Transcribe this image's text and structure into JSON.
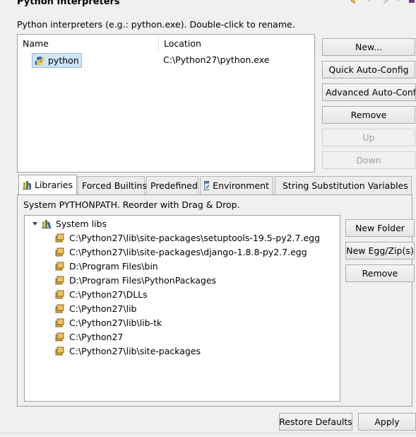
{
  "header": {
    "title": "Python Interpreters",
    "description": "Python interpreters (e.g.: python.exe).   Double-click to rename."
  },
  "interpreters": {
    "columns": [
      "Name",
      "Location"
    ],
    "rows": [
      {
        "name": "python",
        "location": "C:\\Python27\\python.exe"
      }
    ]
  },
  "side_buttons": {
    "new": "New...",
    "quick_auto_config": "Quick Auto-Config",
    "advanced_auto_config": "Advanced Auto-Config",
    "remove": "Remove",
    "up": "Up",
    "down": "Down"
  },
  "tabs": [
    {
      "label": "Libraries",
      "icon": "libraries-icon"
    },
    {
      "label": "Forced Builtins"
    },
    {
      "label": "Predefined"
    },
    {
      "label": "Environment",
      "icon": "environment-icon"
    },
    {
      "label": "String Substitution Variables",
      "icon": "variables-icon"
    }
  ],
  "libraries": {
    "description": "System PYTHONPATH.   Reorder with Drag & Drop.",
    "root_label": "System libs",
    "items": [
      "C:\\Python27\\lib\\site-packages\\setuptools-19.5-py2.7.egg",
      "C:\\Python27\\lib\\site-packages\\django-1.8.8-py2.7.egg",
      "D:\\Program Files\\bin",
      "D:\\Program Files\\PythonPackages",
      "C:\\Python27\\DLLs",
      "C:\\Python27\\lib",
      "C:\\Python27\\lib\\lib-tk",
      "C:\\Python27",
      "C:\\Python27\\lib\\site-packages"
    ],
    "buttons": {
      "new_folder": "New Folder",
      "new_egg": "New Egg/Zip(s)",
      "remove": "Remove"
    }
  },
  "footer": {
    "restore_defaults": "Restore Defaults",
    "apply": "Apply"
  },
  "colors": {
    "selection": "#cde5f9",
    "selection_border": "#5e8fc3",
    "disabled_text": "#a0a0a0"
  }
}
